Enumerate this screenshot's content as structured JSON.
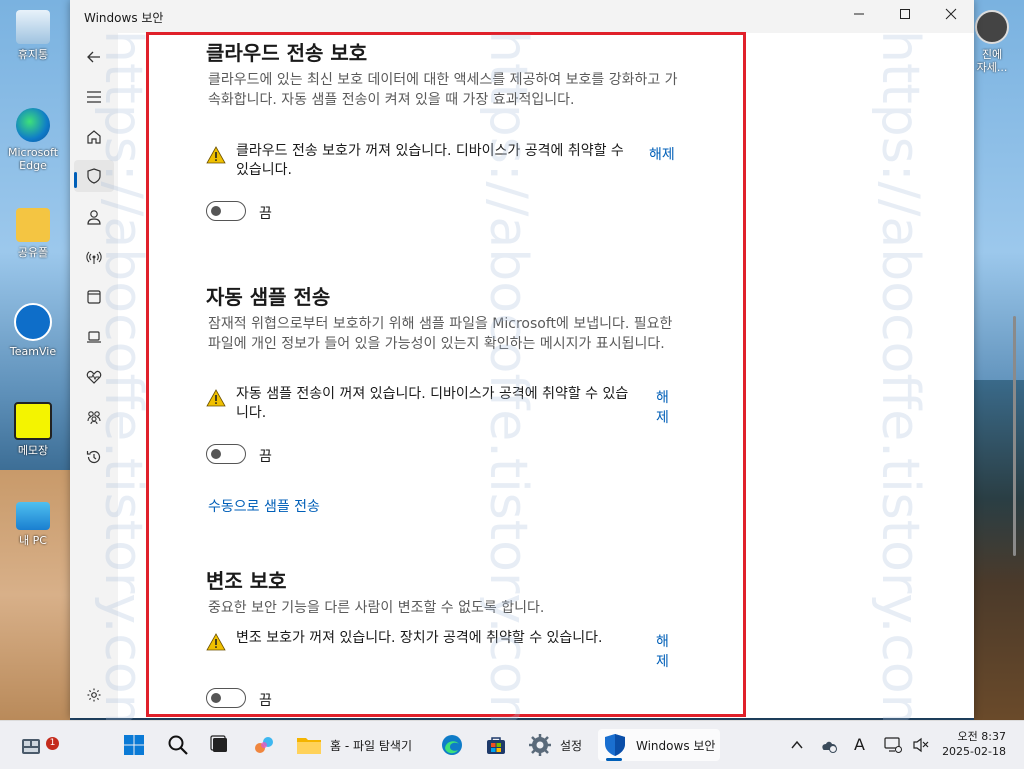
{
  "window": {
    "title": "Windows 보안",
    "minimize": "—",
    "maximize": "☐",
    "close": "✕"
  },
  "desktop": {
    "icons": [
      {
        "label": "휴지통"
      },
      {
        "label": "Microsoft Edge"
      },
      {
        "label": "공유폴"
      },
      {
        "label": "TeamVie"
      },
      {
        "label": "메모장"
      },
      {
        "label": "내 PC"
      }
    ],
    "right_icon_label": "진에\n자세..."
  },
  "nav": {
    "items": [
      "back",
      "menu",
      "home",
      "virus-protection",
      "account",
      "firewall",
      "app-browser",
      "device-security",
      "device-health",
      "family",
      "history"
    ],
    "settings": "settings"
  },
  "sections": {
    "cloud": {
      "title": "클라우드 전송 보호",
      "desc": "클라우드에 있는 최신 보호 데이터에 대한 액세스를 제공하여 보호를 강화하고 가속화합니다. 자동 샘플 전송이 켜져 있을 때 가장 효과적입니다.",
      "warning": "클라우드 전송 보호가 꺼져 있습니다. 디바이스가 공격에 취약할 수 있습니다.",
      "dismiss": "해제",
      "toggle_label": "끔"
    },
    "sample": {
      "title": "자동 샘플 전송",
      "desc": "잠재적 위협으로부터 보호하기 위해 샘플 파일을 Microsoft에 보냅니다. 필요한 파일에 개인 정보가 들어 있을 가능성이 있는지 확인하는 메시지가 표시됩니다.",
      "warning": "자동 샘플 전송이 꺼져 있습니다. 디바이스가 공격에 취약할 수 있습니다.",
      "dismiss": "해제",
      "toggle_label": "끔",
      "manual_link": "수동으로 샘플 전송"
    },
    "tamper": {
      "title": "변조 보호",
      "desc": "중요한 보안 기능을 다른 사람이 변조할 수 없도록 합니다.",
      "warning": "변조 보호가 꺼져 있습니다. 장치가 공격에 취약할 수 있습니다.",
      "dismiss": "해제",
      "toggle_label": "끔"
    }
  },
  "taskbar": {
    "widgets_badge": "1",
    "explorer_label": "홈 - 파일 탐색기",
    "settings_label": "설정",
    "security_label": "Windows 보안",
    "ime": "A",
    "time": "오전 8:37",
    "date": "2025-02-18"
  },
  "watermark": "https://abocoffe.tistory.com",
  "colors": {
    "accent": "#005fb8",
    "highlight_box": "#e0202a",
    "warning": "#f0c000"
  }
}
